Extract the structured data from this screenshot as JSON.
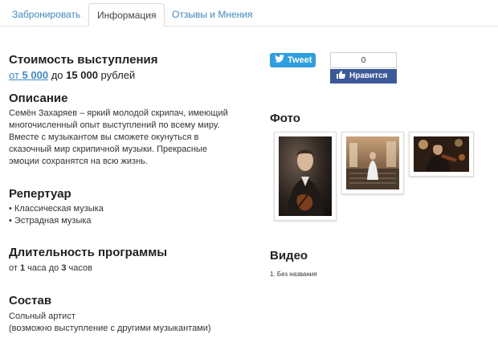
{
  "tabs": [
    {
      "label": "Забронировать"
    },
    {
      "label": "Информация"
    },
    {
      "label": "Отзывы и Мнения"
    }
  ],
  "price": {
    "heading": "Стоимость выступления",
    "from_word": "от",
    "from_value": "5 000",
    "to_word": "до",
    "to_value": "15 000",
    "currency": "рублей"
  },
  "description": {
    "heading": "Описание",
    "lines": [
      "Семён Захаряев – яркий молодой скрипач, имеющий",
      "многочисленный опыт выступлений по всему миру.",
      "Вместе с музыкантом вы сможете окунуться в",
      "сказочный мир скрипичной музыки. Прекрасные",
      "эмоции сохранятся на всю жизнь."
    ]
  },
  "repertoire": {
    "heading": "Репертуар",
    "items": [
      "• Классическая музыка",
      "• Эстрадная музыка"
    ]
  },
  "duration": {
    "heading": "Длительность программы",
    "from_word": "от",
    "from_value": "1",
    "from_unit": "часа",
    "to_word": "до",
    "to_value": "3",
    "to_unit": "часов"
  },
  "lineup": {
    "heading": "Состав",
    "line1": "Сольный артист",
    "line2": "(возможно выступление с другими музыкантами)"
  },
  "social": {
    "tweet_label": "Tweet",
    "like_count": "0",
    "like_label": "Нравится"
  },
  "photos": {
    "heading": "Фото"
  },
  "video": {
    "heading": "Видео",
    "items": [
      "1. Без названия"
    ]
  },
  "colors": {
    "link": "#3a8bcd",
    "twitter": "#2d9fe0",
    "facebook": "#3b5998"
  }
}
